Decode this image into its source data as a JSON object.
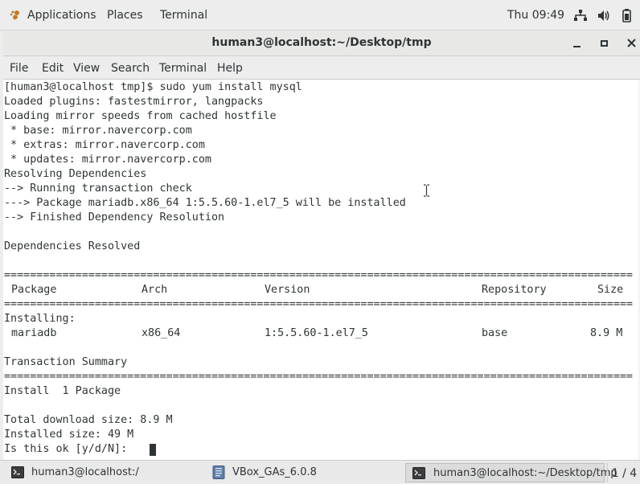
{
  "topbar": {
    "applications": "Applications",
    "places": "Places",
    "terminal": "Terminal",
    "clock": "Thu 09:49"
  },
  "window": {
    "title": "human3@localhost:~/Desktop/tmp"
  },
  "menu": [
    "File",
    "Edit",
    "View",
    "Search",
    "Terminal",
    "Help"
  ],
  "terminal": {
    "lines": [
      "[human3@localhost tmp]$ sudo yum install mysql",
      "Loaded plugins: fastestmirror, langpacks",
      "Loading mirror speeds from cached hostfile",
      " * base: mirror.navercorp.com",
      " * extras: mirror.navercorp.com",
      " * updates: mirror.navercorp.com",
      "Resolving Dependencies",
      "--> Running transaction check",
      "---> Package mariadb.x86_64 1:5.5.60-1.el7_5 will be installed",
      "--> Finished Dependency Resolution",
      "",
      "Dependencies Resolved",
      "",
      "====================================================================================================",
      "",
      "====================================================================================================",
      "Installing:",
      "",
      "",
      "Transaction Summary",
      "====================================================================================================",
      "Install  1 Package",
      "",
      "Total download size: 8.9 M",
      "Installed size: 49 M",
      "Is this ok [y/d/N]: "
    ],
    "table_header": {
      "package": "Package",
      "arch": "Arch",
      "version": "Version",
      "repository": "Repository",
      "size": "Size"
    },
    "table_row": {
      "package": "mariadb",
      "arch": "x86_64",
      "version": "1:5.5.60-1.el7_5",
      "repository": "base",
      "size": "8.9 M"
    }
  },
  "taskbar": {
    "tasks": [
      {
        "label": "human3@localhost:/",
        "icon": "terminal-icon"
      },
      {
        "label": "VBox_GAs_6.0.8",
        "icon": "disc-icon"
      },
      {
        "label": "human3@localhost:~/Desktop/tmp",
        "icon": "terminal-icon"
      }
    ],
    "pager": "1 / 4"
  },
  "colors": {
    "text": "#2e3436",
    "terminal_bg": "#ffffff",
    "chrome_bg": "#ededed"
  }
}
